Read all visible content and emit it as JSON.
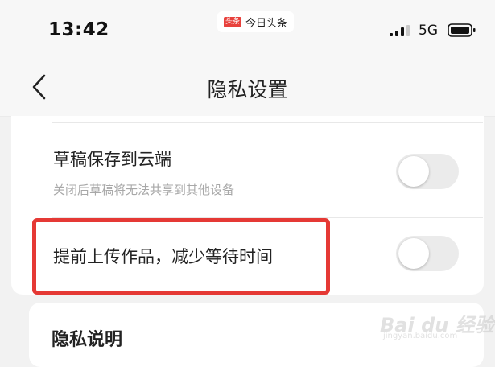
{
  "status_bar": {
    "time": "13:42",
    "app_logo": "头条",
    "app_name": "今日头条",
    "network": "5G",
    "icons": [
      "signal-icon",
      "battery-icon"
    ]
  },
  "nav": {
    "title": "隐私设置",
    "back_icon": "chevron-left-icon"
  },
  "settings": {
    "items": [
      {
        "title": "草稿保存到云端",
        "subtitle": "关闭后草稿将无法共享到其他设备",
        "toggle_on": false
      },
      {
        "title": "提前上传作品，减少等待时间",
        "toggle_on": false
      }
    ]
  },
  "privacy_section": {
    "title": "隐私说明"
  },
  "watermark": {
    "text": "Bai du 经验",
    "subtext": "jingyan.baidu.com"
  },
  "colors": {
    "highlight": "#e53935",
    "toggle_off": "#ebebeb",
    "background": "#f2f2f2"
  }
}
